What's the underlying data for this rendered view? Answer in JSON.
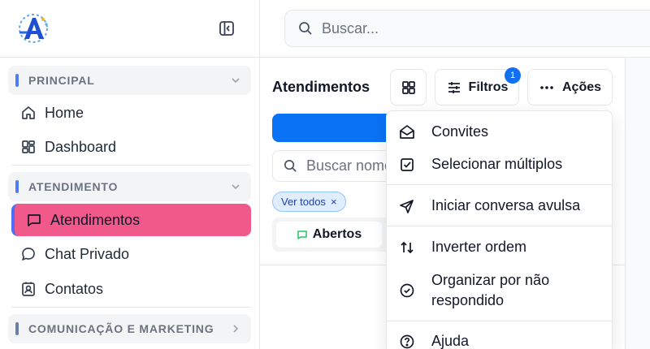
{
  "sidebar": {
    "sections": [
      {
        "label": "PRINCIPAL",
        "accent": "#4f7df5"
      },
      {
        "label": "ATENDIMENTO",
        "accent": "#4f7df5"
      },
      {
        "label": "COMUNICAÇÃO E MARKETING",
        "accent": "#6b7fa8"
      }
    ],
    "items": [
      {
        "label": "Home",
        "icon": "home-icon"
      },
      {
        "label": "Dashboard",
        "icon": "dashboard-icon"
      },
      {
        "label": "Atendimentos",
        "icon": "chat-square-icon",
        "active": true,
        "active_color": "#f0598a"
      },
      {
        "label": "Chat Privado",
        "icon": "chat-bubble-icon"
      },
      {
        "label": "Contatos",
        "icon": "contact-card-icon"
      }
    ]
  },
  "search": {
    "placeholder": "Buscar..."
  },
  "main": {
    "title": "Atendimentos",
    "filters_label": "Filtros",
    "filters_count": "1",
    "actions_label": "Ações",
    "search_placeholder": "Buscar nome ou número",
    "chip_label": "Ver todos",
    "chip_close": "×",
    "tab_label": "Abertos",
    "primary_color": "#0a72f5"
  },
  "menu": {
    "items": [
      {
        "label": "Convites",
        "icon": "envelope-open-icon"
      },
      {
        "label": "Selecionar múltiplos",
        "icon": "checkbox-icon"
      },
      {
        "label": "Iniciar conversa avulsa",
        "icon": "send-icon"
      },
      {
        "label": "Inverter ordem",
        "icon": "swap-vertical-icon"
      },
      {
        "label": "Organizar por não respondido",
        "icon": "check-circle-icon"
      },
      {
        "label": "Ajuda",
        "icon": "help-circle-icon"
      }
    ]
  }
}
